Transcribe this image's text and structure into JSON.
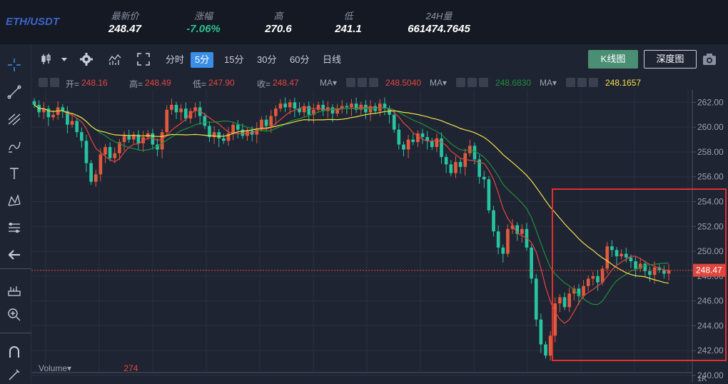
{
  "header": {
    "pair": "ETH/USDT",
    "stats": [
      {
        "label": "最新价",
        "value": "248.47",
        "color": "white"
      },
      {
        "label": "涨幅",
        "value": "-7.06%",
        "color": "green"
      },
      {
        "label": "高",
        "value": "270.6",
        "color": "white"
      },
      {
        "label": "低",
        "value": "241.1",
        "color": "white"
      },
      {
        "label": "24H量",
        "value": "661474.7645",
        "color": "white"
      }
    ]
  },
  "toolbar": {
    "periods": [
      "分时",
      "5分",
      "15分",
      "30分",
      "60分",
      "日线"
    ],
    "active_period": "5分",
    "kline_button": "K线图",
    "depth_button": "深度图"
  },
  "legend": {
    "open_label": "开=",
    "open": "248.16",
    "high_label": "高=",
    "high": "248.49",
    "low_label": "低=",
    "low": "247.90",
    "close_label": "收=",
    "close": "248.47",
    "ma_label": "MA▾",
    "ma1": "248.5040",
    "ma2": "248.6830",
    "ma3": "248.1657"
  },
  "volume": {
    "label": "Volume▾",
    "value": "274"
  },
  "chart_data": {
    "type": "candlestick",
    "y_ticks": [
      "262.00",
      "260.00",
      "258.00",
      "256.00",
      "254.00",
      "252.00",
      "250.00",
      "248.00",
      "246.00",
      "244.00",
      "242.00",
      "240.00"
    ],
    "ylim": [
      240,
      263
    ],
    "current_price": "248.47",
    "volume_axis_label": "1K",
    "ma_colors": {
      "ma1": "#e0463d",
      "ma2": "#1f8f3a",
      "ma3": "#f2e24a"
    },
    "up_color": "#e05a3d",
    "down_color": "#26c5a0",
    "closes": [
      261.8,
      261.2,
      261.5,
      260.8,
      261.0,
      261.6,
      261.3,
      260.2,
      260.5,
      259.6,
      258.9,
      257.1,
      255.6,
      256.2,
      257.8,
      258.4,
      257.5,
      257.9,
      258.8,
      259.3,
      259.0,
      259.4,
      258.7,
      259.2,
      259.5,
      258.6,
      258.2,
      259.6,
      261.4,
      261.8,
      261.2,
      261.5,
      260.7,
      261.3,
      261.6,
      260.9,
      260.1,
      259.2,
      259.6,
      259.1,
      258.9,
      259.5,
      260.2,
      259.8,
      259.3,
      259.7,
      259.4,
      259.9,
      260.6,
      260.1,
      260.9,
      261.5,
      261.9,
      261.6,
      262.0,
      261.5,
      261.2,
      261.7,
      261.0,
      261.4,
      261.8,
      261.3,
      261.6,
      261.1,
      261.5,
      261.7,
      261.6,
      261.9,
      261.4,
      261.8,
      261.2,
      261.7,
      261.3,
      261.9,
      261.5,
      261.0,
      259.8,
      258.6,
      258.2,
      259.0,
      258.8,
      259.5,
      259.2,
      258.9,
      258.4,
      259.1,
      257.6,
      257.0,
      256.3,
      257.2,
      256.8,
      257.9,
      258.5,
      257.4,
      256.0,
      255.8,
      253.3,
      251.6,
      250.3,
      249.8,
      251.8,
      252.1,
      251.4,
      251.8,
      250.3,
      247.8,
      244.5,
      242.5,
      241.6,
      243.2,
      245.8,
      246.3,
      245.5,
      246.6,
      247.0,
      246.4,
      247.2,
      247.8,
      248.0,
      247.5,
      248.6,
      250.4,
      250.1,
      249.6,
      249.8,
      249.5,
      249.2,
      248.6,
      249.0,
      248.4,
      248.1,
      248.7,
      248.5,
      248.2,
      248.47
    ]
  }
}
